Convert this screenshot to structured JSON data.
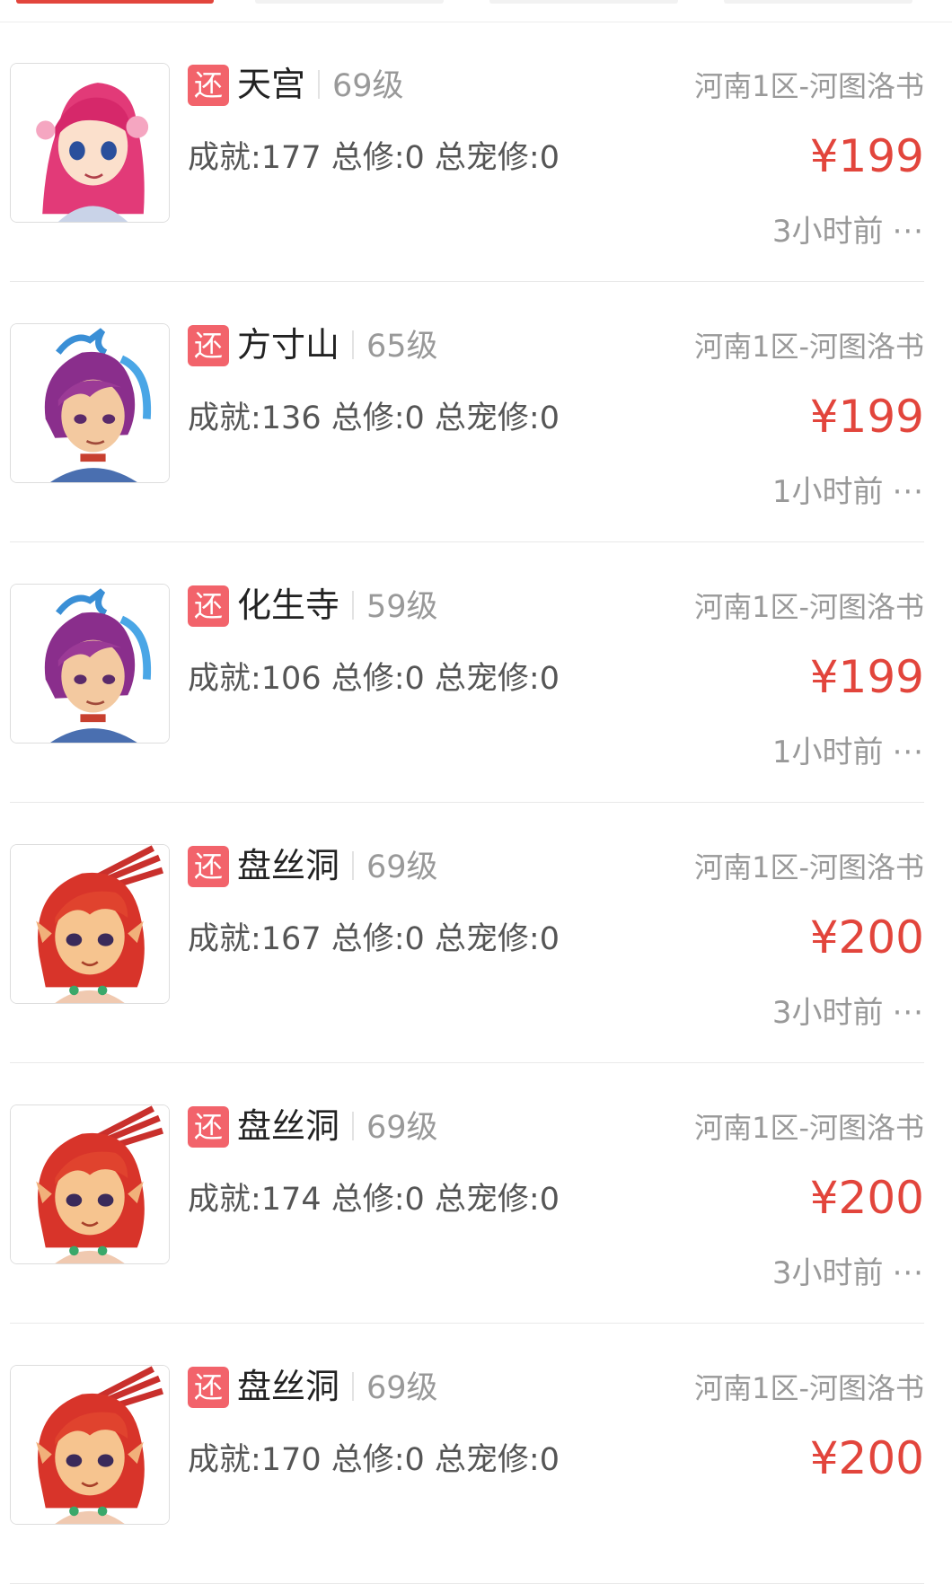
{
  "listings": [
    {
      "tag": "还",
      "school": "天宫",
      "level": "69级",
      "server": "河南1区-河图洛书",
      "stats": "成就:177 总修:0 总宠修:0",
      "price": "¥199",
      "time": "3小时前",
      "avatar": "pink-hair-girl-icon"
    },
    {
      "tag": "还",
      "school": "方寸山",
      "level": "65级",
      "server": "河南1区-河图洛书",
      "stats": "成就:136 总修:0 总宠修:0",
      "price": "¥199",
      "time": "1小时前",
      "avatar": "purple-hair-boy-icon"
    },
    {
      "tag": "还",
      "school": "化生寺",
      "level": "59级",
      "server": "河南1区-河图洛书",
      "stats": "成就:106 总修:0 总宠修:0",
      "price": "¥199",
      "time": "1小时前",
      "avatar": "purple-hair-boy-icon"
    },
    {
      "tag": "还",
      "school": "盘丝洞",
      "level": "69级",
      "server": "河南1区-河图洛书",
      "stats": "成就:167 总修:0 总宠修:0",
      "price": "¥200",
      "time": "3小时前",
      "avatar": "red-hair-elf-girl-icon"
    },
    {
      "tag": "还",
      "school": "盘丝洞",
      "level": "69级",
      "server": "河南1区-河图洛书",
      "stats": "成就:174 总修:0 总宠修:0",
      "price": "¥200",
      "time": "3小时前",
      "avatar": "red-hair-elf-girl-icon"
    },
    {
      "tag": "还",
      "school": "盘丝洞",
      "level": "69级",
      "server": "河南1区-河图洛书",
      "stats": "成就:170 总修:0 总宠修:0",
      "price": "¥200",
      "time": "",
      "avatar": "red-hair-elf-girl-icon"
    }
  ],
  "more_glyph": "···",
  "colors": {
    "price": "#e2453c",
    "tag_bg": "#f2636b",
    "muted": "#999999"
  }
}
